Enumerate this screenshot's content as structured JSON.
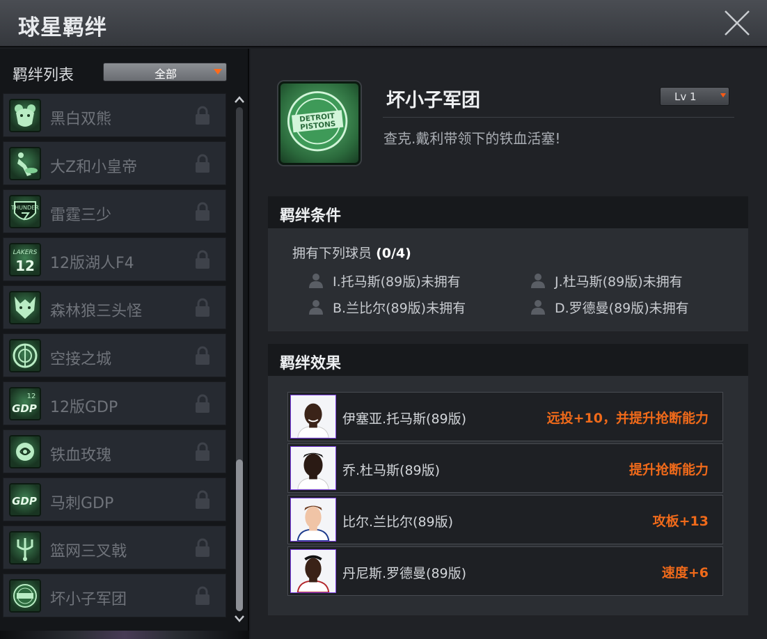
{
  "window": {
    "title": "球星羁绊"
  },
  "sidebar": {
    "label": "羁绊列表",
    "filter": "全部",
    "items": [
      {
        "label": "黑白双熊",
        "icon": "bear-icon",
        "locked": true
      },
      {
        "label": "大Z和小皇帝",
        "icon": "dunk-player-icon",
        "locked": true
      },
      {
        "label": "雷霆三少",
        "icon": "thunder-logo-icon",
        "locked": true
      },
      {
        "label": "12版湖人F4",
        "icon": "lakers-12-icon",
        "locked": true
      },
      {
        "label": "森林狼三头怪",
        "icon": "wolf-icon",
        "locked": true
      },
      {
        "label": "空接之城",
        "icon": "clippers-logo-icon",
        "locked": true
      },
      {
        "label": "12版GDP",
        "icon": "gdp-12-icon",
        "locked": true
      },
      {
        "label": "铁血玫瑰",
        "icon": "rose-icon",
        "locked": true
      },
      {
        "label": "马刺GDP",
        "icon": "gdp-icon",
        "locked": true
      },
      {
        "label": "篮网三叉戟",
        "icon": "trident-icon",
        "locked": true
      },
      {
        "label": "坏小子军团",
        "icon": "pistons-logo-icon",
        "locked": true
      }
    ]
  },
  "detail": {
    "name": "坏小子军团",
    "description": "查克.戴利带领下的铁血活塞!",
    "level": "Lv 1",
    "badge_text_1": "DETROIT",
    "badge_text_2": "PISTONS",
    "conditions": {
      "title": "羁绊条件",
      "intro": "拥有下列球员",
      "progress": "(0/4)",
      "players": [
        "I.托马斯(89版)未拥有",
        "J.杜马斯(89版)未拥有",
        "B.兰比尔(89版)未拥有",
        "D.罗德曼(89版)未拥有"
      ]
    },
    "effects": {
      "title": "羁绊效果",
      "rows": [
        {
          "player": "伊塞亚.托马斯(89版)",
          "effect": "远投+10，并提升抢断能力"
        },
        {
          "player": "乔.杜马斯(89版)",
          "effect": "提升抢断能力"
        },
        {
          "player": "比尔.兰比尔(89版)",
          "effect": "攻板+13"
        },
        {
          "player": "丹尼斯.罗德曼(89版)",
          "effect": "速度+6"
        }
      ]
    }
  },
  "colors": {
    "accent_orange": "#f06a1a",
    "badge_green": "#3e7f52",
    "avatar_border": "#7a3de0"
  }
}
